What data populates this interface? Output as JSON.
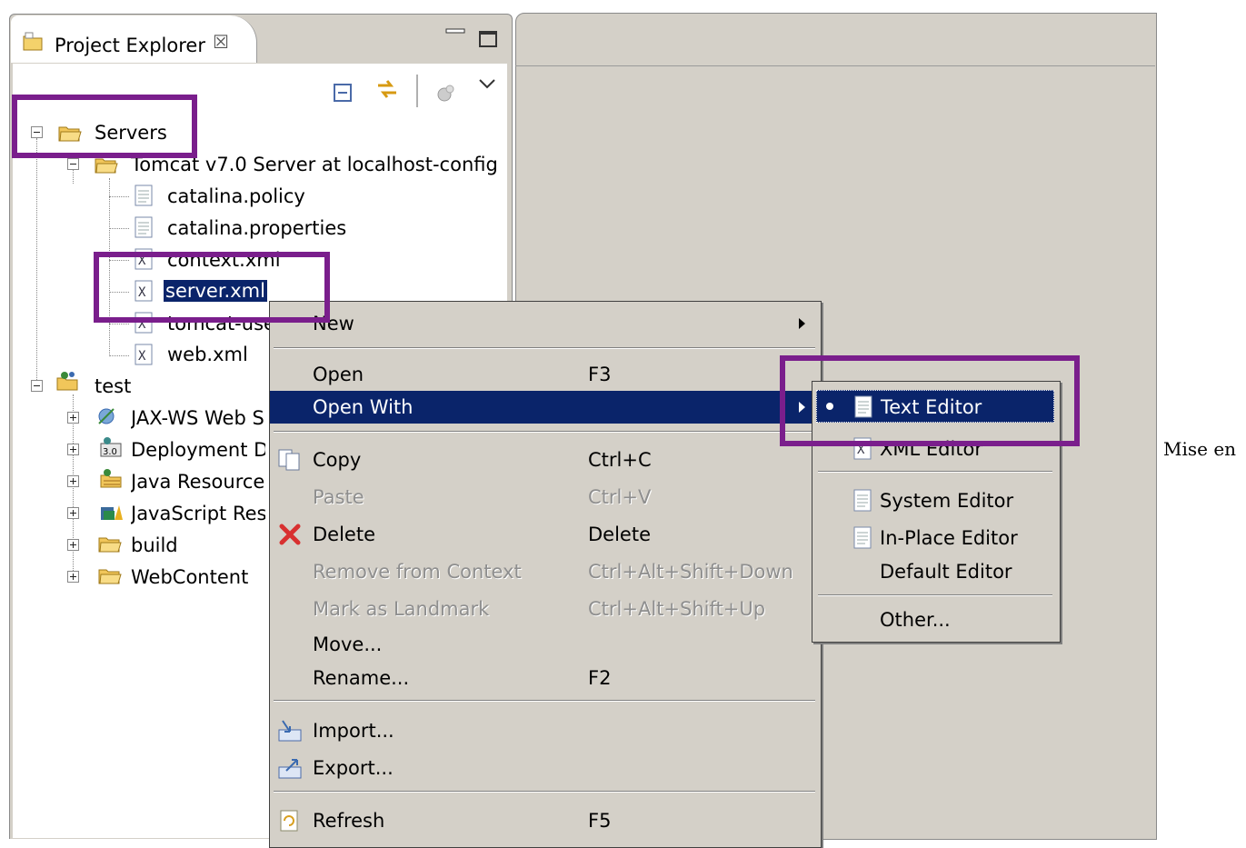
{
  "panel": {
    "title": "Project Explorer",
    "close_glyph": "☒"
  },
  "tree": [
    {
      "id": "servers",
      "label": "Servers",
      "icon": "folder-open-icon"
    },
    {
      "id": "tomcat",
      "label": "Tomcat v7.0 Server at localhost-config",
      "icon": "folder-open-icon"
    },
    {
      "id": "catalina-policy",
      "label": "catalina.policy",
      "icon": "file-icon"
    },
    {
      "id": "catalina-properties",
      "label": "catalina.properties",
      "icon": "file-icon"
    },
    {
      "id": "context-xml",
      "label": "context.xml",
      "icon": "xml-file-icon"
    },
    {
      "id": "server-xml",
      "label": "server.xml",
      "icon": "xml-file-icon",
      "selected": true
    },
    {
      "id": "tomcat-users",
      "label": "tomcat-users.xml",
      "icon": "xml-file-icon"
    },
    {
      "id": "web-xml",
      "label": "web.xml",
      "icon": "xml-file-icon"
    },
    {
      "id": "test",
      "label": "test",
      "icon": "project-icon"
    },
    {
      "id": "jaxws",
      "label": "JAX-WS Web Services",
      "icon": "web-services-icon"
    },
    {
      "id": "deploy",
      "label": "Deployment Descriptor",
      "icon": "deployment-descriptor-icon"
    },
    {
      "id": "javares",
      "label": "Java Resources",
      "icon": "java-resources-icon"
    },
    {
      "id": "jsres",
      "label": "JavaScript Resources",
      "icon": "javascript-resources-icon"
    },
    {
      "id": "build",
      "label": "build",
      "icon": "folder-icon"
    },
    {
      "id": "webcontent",
      "label": "WebContent",
      "icon": "folder-icon"
    }
  ],
  "context_menu": {
    "new": {
      "label": "New"
    },
    "open": {
      "label": "Open",
      "shortcut": "F3"
    },
    "open_with": {
      "label": "Open With"
    },
    "copy": {
      "label": "Copy",
      "shortcut": "Ctrl+C"
    },
    "paste": {
      "label": "Paste",
      "shortcut": "Ctrl+V"
    },
    "delete": {
      "label": "Delete",
      "shortcut": "Delete"
    },
    "remove_context": {
      "label": "Remove from Context",
      "shortcut": "Ctrl+Alt+Shift+Down"
    },
    "mark_landmark": {
      "label": "Mark as Landmark",
      "shortcut": "Ctrl+Alt+Shift+Up"
    },
    "move": {
      "label": "Move..."
    },
    "rename": {
      "label": "Rename...",
      "shortcut": "F2"
    },
    "import": {
      "label": "Import..."
    },
    "export": {
      "label": "Export..."
    },
    "refresh": {
      "label": "Refresh",
      "shortcut": "F5"
    }
  },
  "submenu": {
    "text_editor": {
      "label": "Text Editor"
    },
    "xml_editor": {
      "label": "XML Editor"
    },
    "system_editor": {
      "label": "System Editor"
    },
    "inplace_editor": {
      "label": "In-Place Editor"
    },
    "default_editor": {
      "label": "Default Editor"
    },
    "other": {
      "label": "Other..."
    }
  },
  "side_text": "Mise en",
  "colors": {
    "selection": "#0a246a",
    "highlight_box": "#7a1e8c",
    "menu_bg": "#d4d0c8"
  }
}
